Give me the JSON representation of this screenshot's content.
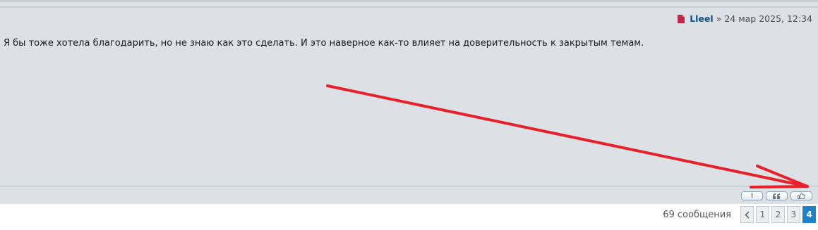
{
  "post": {
    "author": "Lleel",
    "separator": "»",
    "date": "24 мар 2025, 12:34",
    "content": "Я бы тоже хотела благодарить, но не знаю как это сделать. И это наверное как-то влияет на доверительность к закрытым темам.",
    "author_color": "#105289",
    "arrow_color": "#e8202a"
  },
  "post_buttons": {
    "report": "!",
    "quote_icon": "quote-icon",
    "thanks_icon": "thumbs-up-icon"
  },
  "pagination": {
    "message_count": "69 сообщения",
    "prev_icon": "chevron-left-icon",
    "pages": [
      "1",
      "2",
      "3",
      "4"
    ],
    "current_page": "4",
    "accent_color": "#1c82c9"
  }
}
